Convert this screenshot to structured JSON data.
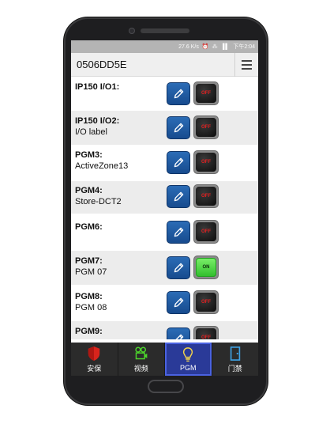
{
  "status_bar": {
    "speed": "27.6 K/s",
    "icons": "⏰ ⁂ ▐▌",
    "time": "下午2:04"
  },
  "header": {
    "title": "0506DD5E"
  },
  "rows": [
    {
      "name": "IP150 I/O1:",
      "desc": "",
      "state": "OFF"
    },
    {
      "name": "IP150 I/O2:",
      "desc": "I/O label",
      "state": "OFF"
    },
    {
      "name": "PGM3:",
      "desc": "ActiveZone13",
      "state": "OFF"
    },
    {
      "name": "PGM4:",
      "desc": "Store-DCT2",
      "state": "OFF"
    },
    {
      "name": "PGM6:",
      "desc": "",
      "state": "OFF"
    },
    {
      "name": "PGM7:",
      "desc": "PGM 07",
      "state": "ON"
    },
    {
      "name": "PGM8:",
      "desc": "PGM 08",
      "state": "OFF"
    },
    {
      "name": "PGM9:",
      "desc": "",
      "state": "OFF"
    }
  ],
  "nav": {
    "security": {
      "label": "安保",
      "icon": "shield-icon",
      "color": "#d9241c"
    },
    "video": {
      "label": "视频",
      "icon": "video-camera-icon",
      "color": "#4cd32c"
    },
    "pgm": {
      "label": "PGM",
      "icon": "light-bulb-icon",
      "color": "#f3d44a"
    },
    "access": {
      "label": "门禁",
      "icon": "door-icon",
      "color": "#3fa3e6"
    }
  },
  "colors": {
    "edit_button": "#1f5da6",
    "toggle_on": "#3fd43a",
    "toggle_off_text": "#e02020",
    "active_tab": "#2a3a98"
  }
}
